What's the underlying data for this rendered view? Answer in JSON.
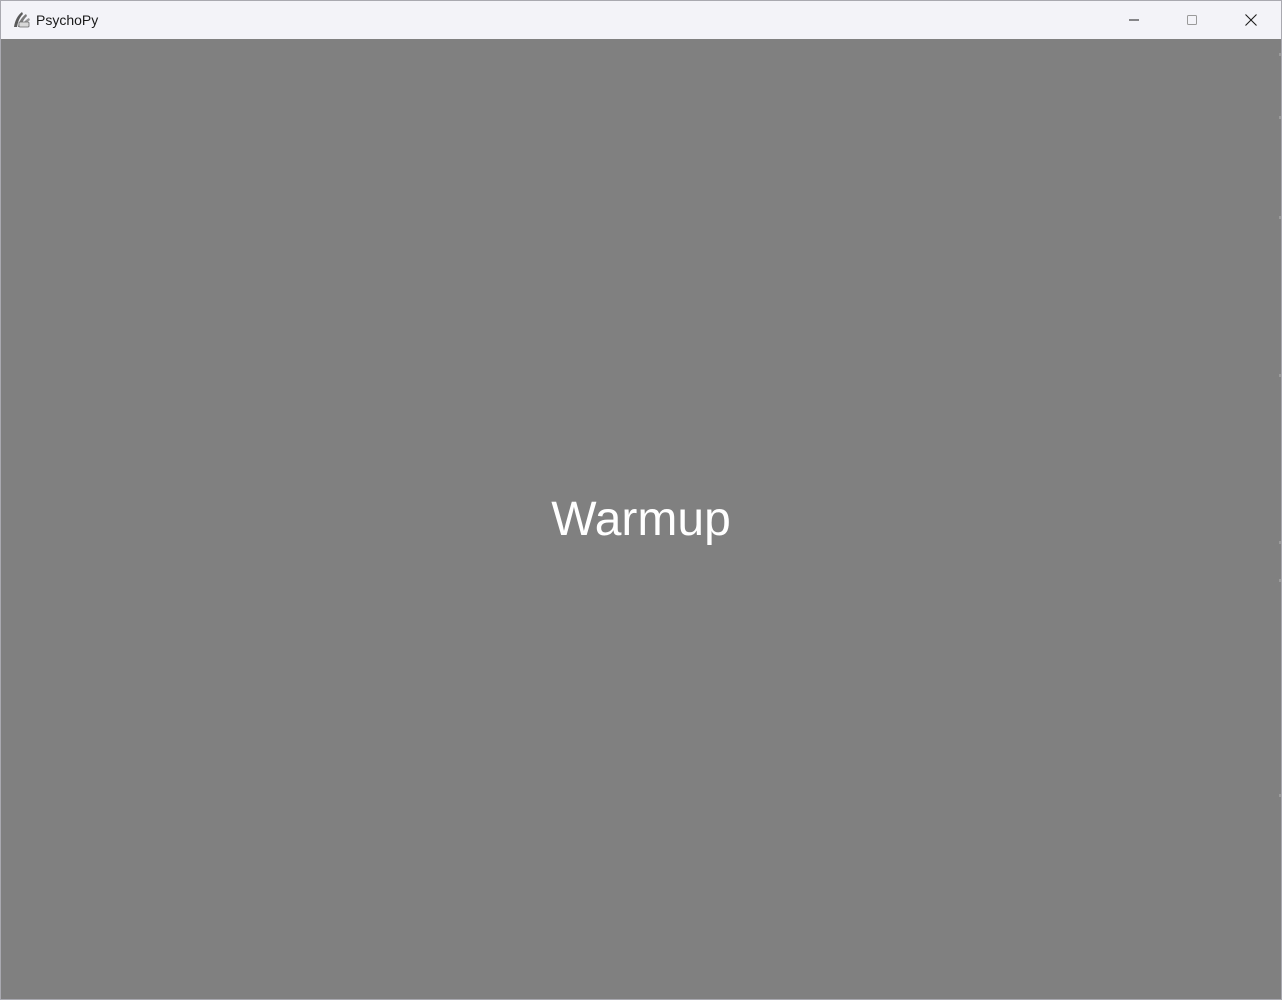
{
  "window": {
    "title": "PsychoPy",
    "icon": "psychopy-icon",
    "background_color": "#808080",
    "titlebar_color": "#f3f3f8"
  },
  "caption_buttons": {
    "minimize_icon": "minimize-icon",
    "maximize_icon": "maximize-icon",
    "close_icon": "close-icon"
  },
  "stimulus": {
    "text": "Warmup",
    "color": "#ffffff"
  }
}
